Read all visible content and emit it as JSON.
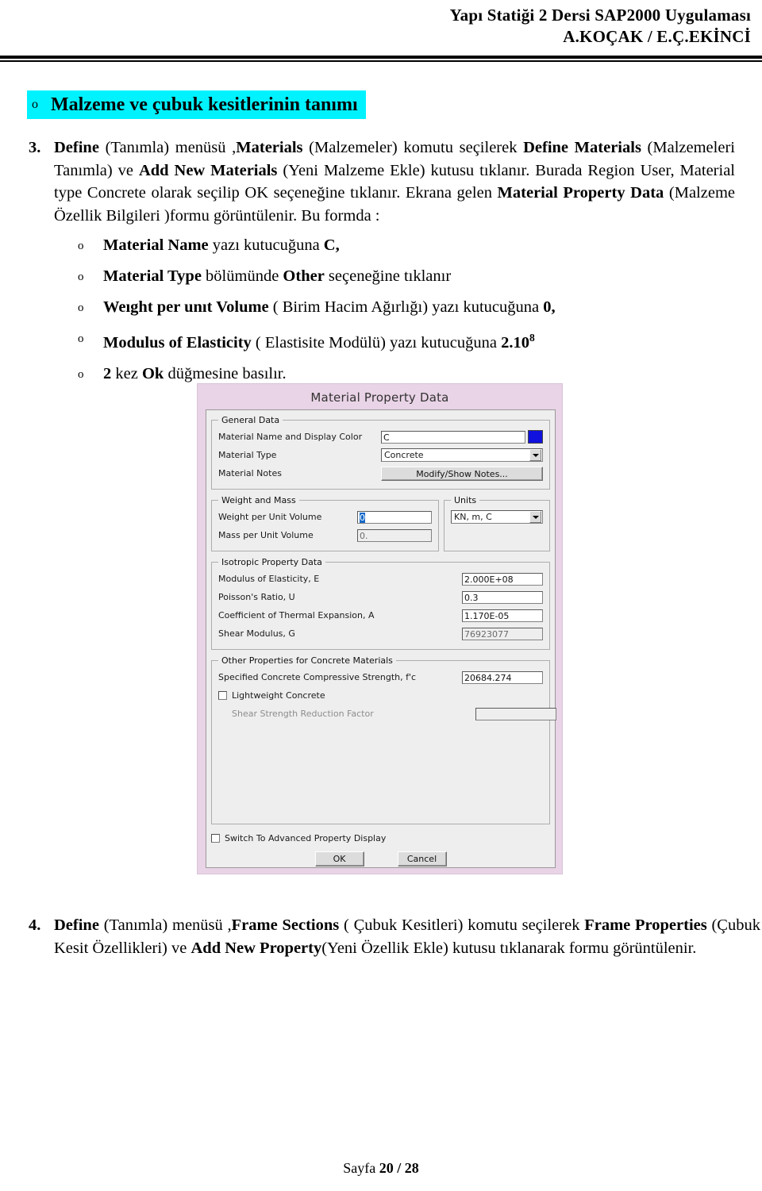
{
  "header": {
    "line1": "Yapı Statiği 2  Dersi SAP2000 Uygulaması",
    "line2": "A.KOÇAK / E.Ç.EKİNCİ"
  },
  "heading": {
    "bullet": "o",
    "text": "Malzeme ve çubuk kesitlerinin tanımı",
    "highlight_color": "#00f2ff"
  },
  "item3": {
    "number": "3.",
    "p1_b1": "Define",
    "p1_t1": " (Tanımla) menüsü ,",
    "p1_b2": "Materials",
    "p1_t2": " (Malzemeler) komutu seçilerek ",
    "p1_b3": "Define Materials",
    "p1_t3": " (Malzemeleri Tanımla) ve ",
    "p1_b4": "Add New Materials",
    "p1_t4": " (Yeni Malzeme Ekle) kutusu tıklanır. Burada Region User, Material type Concrete olarak seçilip OK seçeneğine tıklanır. Ekrana gelen ",
    "p1_b5": "Material Property Data",
    "p1_t5": " (Malzeme Özellik Bilgileri )formu görüntülenir. Bu formda :"
  },
  "bullets": [
    {
      "marker": "o",
      "b1": "Material Name",
      "t1": " yazı kutucuğuna ",
      "b2": "C,",
      "t2": ""
    },
    {
      "marker": "o",
      "b1": "Material Type",
      "t1": " bölümünde ",
      "b2": "Other",
      "t2": " seçeneğine tıklanır"
    },
    {
      "marker": "o",
      "b1": "Weıght per unıt Volume",
      "t1": " ( Birim Hacim Ağırlığı) yazı kutucuğuna ",
      "b2": "0,",
      "t2": ""
    },
    {
      "marker": "o",
      "b1": "Modulus of Elasticity",
      "t1": " ( Elastisite Modülü) yazı kutucuğuna ",
      "b2": "2.10",
      "sup": "8",
      "t2": ""
    },
    {
      "marker": "o",
      "b1": "2",
      "t1": " kez ",
      "b2": "Ok",
      "t2": " düğmesine basılır."
    }
  ],
  "dialog": {
    "title": "Material Property Data",
    "groups": {
      "general": {
        "legend": "General Data",
        "name_label": "Material Name and Display Color",
        "name_value": "C",
        "color_swatch": "#1111dd",
        "type_label": "Material Type",
        "type_value": "Concrete",
        "notes_label": "Material Notes",
        "notes_button": "Modify/Show Notes..."
      },
      "weight_mass": {
        "legend": "Weight and Mass",
        "weight_label": "Weight per Unit Volume",
        "weight_value": "0",
        "mass_label": "Mass per Unit Volume",
        "mass_value": "0."
      },
      "units": {
        "legend": "Units",
        "value": "KN, m, C"
      },
      "isotropic": {
        "legend": "Isotropic Property Data",
        "rows": [
          {
            "label": "Modulus of Elasticity,  E",
            "value": "2.000E+08"
          },
          {
            "label": "Poisson's Ratio,  U",
            "value": "0.3"
          },
          {
            "label": "Coefficient of Thermal Expansion,  A",
            "value": "1.170E-05"
          },
          {
            "label": "Shear Modulus,  G",
            "value": "76923077"
          }
        ]
      },
      "other": {
        "legend": "Other Properties for Concrete Materials",
        "fc_label": "Specified Concrete Compressive Strength, f'c",
        "fc_value": "20684.274",
        "lightweight_label": "Lightweight Concrete",
        "shear_label": "Shear Strength Reduction Factor",
        "shear_value": ""
      }
    },
    "advanced_label": "Switch To Advanced Property Display",
    "ok_button": "OK",
    "cancel_button": "Cancel"
  },
  "item4": {
    "number": "4.",
    "p_b1": "Define",
    "p_t1": " (Tanımla) menüsü ,",
    "p_b2": "Frame Sections",
    "p_t2": " ( Çubuk Kesitleri) komutu seçilerek ",
    "p_b3": "Frame Properties",
    "p_t3": " (Çubuk Kesit Özellikleri) ve ",
    "p_b4": "Add New Property",
    "p_t4": "(Yeni Özellik Ekle) kutusu tıklanarak formu görüntülenir."
  },
  "footer": {
    "prefix": "Sayfa ",
    "page": "20 / 28"
  }
}
